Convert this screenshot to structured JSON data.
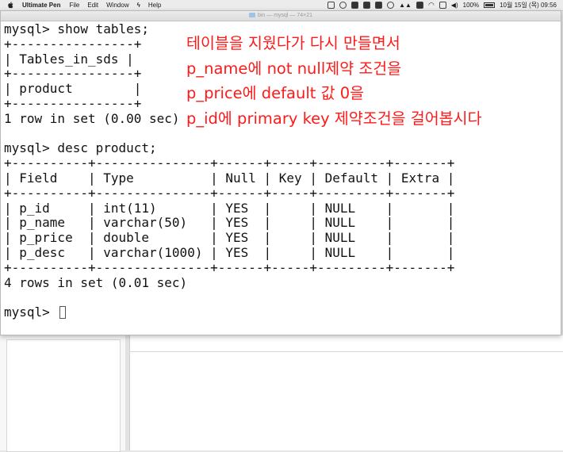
{
  "menubar": {
    "app_name": "Ultimate Pen",
    "items": [
      "File",
      "Edit",
      "Window",
      "Help"
    ],
    "battery": "100%",
    "clock": "10월 15일 (목)  09:56"
  },
  "window": {
    "title": "bin — mysql — 74×21"
  },
  "terminal": {
    "lines": [
      "mysql> show tables;",
      "+----------------+",
      "| Tables_in_sds |",
      "+----------------+",
      "| product        |",
      "+----------------+",
      "1 row in set (0.00 sec)",
      "",
      "mysql> desc product;",
      "+----------+---------------+------+-----+---------+-------+",
      "| Field    | Type          | Null | Key | Default | Extra |",
      "+----------+---------------+------+-----+---------+-------+",
      "| p_id     | int(11)       | YES  |     | NULL    |       |",
      "| p_name   | varchar(50)   | YES  |     | NULL    |       |",
      "| p_price  | double        | YES  |     | NULL    |       |",
      "| p_desc   | varchar(1000) | YES  |     | NULL    |       |",
      "+----------+---------------+------+-----+---------+-------+",
      "4 rows in set (0.01 sec)",
      "",
      "mysql> "
    ]
  },
  "annotation": {
    "lines": [
      "테이블을 지웠다가 다시 만들면서",
      "p_name에 not null제약 조건을",
      "p_price에 default 값 0을",
      "p_id에 primary key 제약조건을 걸어봅시다"
    ],
    "color": "#ff1a1a"
  }
}
